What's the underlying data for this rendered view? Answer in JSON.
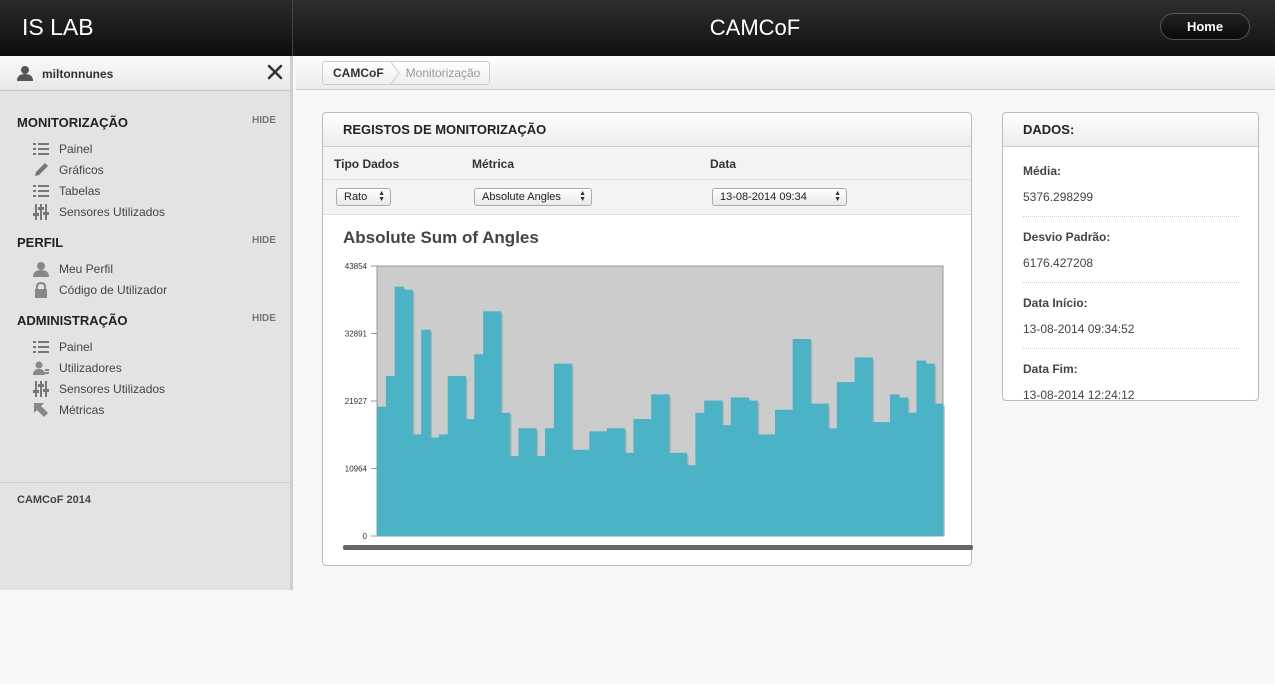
{
  "header": {
    "brand": "IS LAB",
    "title": "CAMCoF",
    "home_label": "Home"
  },
  "sidebar": {
    "username": "miltonnunes",
    "sections": [
      {
        "title": "MONITORIZAÇÃO",
        "hide": "HIDE",
        "items": [
          {
            "label": "Painel",
            "icon": "list-icon"
          },
          {
            "label": "Gráficos",
            "icon": "pencil-icon"
          },
          {
            "label": "Tabelas",
            "icon": "list-icon"
          },
          {
            "label": "Sensores Utilizados",
            "icon": "sliders-icon"
          }
        ]
      },
      {
        "title": "PERFIL",
        "hide": "HIDE",
        "items": [
          {
            "label": "Meu Perfil",
            "icon": "user-icon"
          },
          {
            "label": "Código de Utilizador",
            "icon": "lock-icon"
          }
        ]
      },
      {
        "title": "ADMINISTRAÇÃO",
        "hide": "HIDE",
        "items": [
          {
            "label": "Painel",
            "icon": "list-icon"
          },
          {
            "label": "Utilizadores",
            "icon": "users-icon"
          },
          {
            "label": "Sensores Utilizados",
            "icon": "sliders-icon"
          },
          {
            "label": "Métricas",
            "icon": "cursor-icon"
          }
        ]
      }
    ],
    "footer": "CAMCoF 2014"
  },
  "breadcrumb": {
    "items": [
      "CAMCoF",
      "Monitorização"
    ]
  },
  "registos": {
    "title": "REGISTOS DE MONITORIZAÇÃO",
    "headers": {
      "tipo": "Tipo Dados",
      "metrica": "Métrica",
      "data": "Data"
    },
    "selects": {
      "tipo": "Rato",
      "metrica": "Absolute Angles",
      "data": "13-08-2014 09:34"
    },
    "chart_title": "Absolute Sum of Angles"
  },
  "chart_data": {
    "type": "area",
    "title": "Absolute Sum of Angles",
    "y_ticks": [
      "43854",
      "32891",
      "21927",
      "10964",
      "0"
    ],
    "ylim": [
      0,
      43854
    ],
    "color": "#4ab3c6",
    "plot_background": "#cccccc",
    "values": [
      21000,
      26000,
      40500,
      40000,
      16500,
      33500,
      16000,
      16500,
      26000,
      26000,
      19000,
      29500,
      36500,
      36500,
      20000,
      13000,
      17500,
      17500,
      13000,
      17500,
      28000,
      28000,
      14000,
      14000,
      17000,
      17000,
      17500,
      17500,
      13500,
      19000,
      19000,
      23000,
      23000,
      13500,
      13500,
      11500,
      20000,
      22000,
      22000,
      18000,
      22500,
      22500,
      22000,
      16500,
      16500,
      20500,
      20500,
      32000,
      32000,
      21500,
      21500,
      17500,
      25000,
      25000,
      29000,
      29000,
      18500,
      18500,
      23000,
      22500,
      20000,
      28500,
      28000,
      21500
    ]
  },
  "dados": {
    "title": "DADOS:",
    "rows": [
      {
        "label": "Média:",
        "value": "5376.298299"
      },
      {
        "label": "Desvio Padrão:",
        "value": "6176.427208"
      },
      {
        "label": "Data Início:",
        "value": "13-08-2014 09:34:52"
      },
      {
        "label": "Data Fim:",
        "value": "13-08-2014 12:24:12"
      }
    ]
  }
}
